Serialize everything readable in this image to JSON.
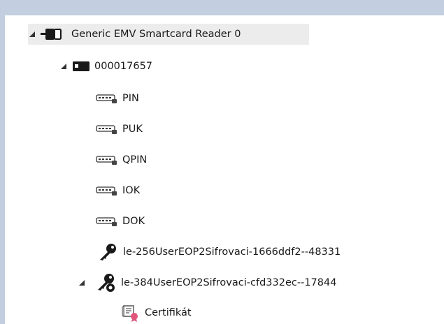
{
  "tree": {
    "reader": {
      "label": "Generic EMV Smartcard Reader 0",
      "icon": "card-reader-icon",
      "expanded": true
    },
    "card": {
      "label": "000017657",
      "icon": "smartcard-icon",
      "expanded": true
    },
    "pins": [
      {
        "label": "PIN",
        "icon": "pin-pad-icon"
      },
      {
        "label": "PUK",
        "icon": "pin-pad-icon"
      },
      {
        "label": "QPIN",
        "icon": "pin-pad-icon"
      },
      {
        "label": "IOK",
        "icon": "pin-pad-icon"
      },
      {
        "label": "DOK",
        "icon": "pin-pad-icon"
      }
    ],
    "keys": [
      {
        "label": "le-256UserEOP2Sifrovaci-1666ddf2--48331",
        "icon": "key-icon",
        "expanded": false
      },
      {
        "label": "le-384UserEOP2Sifrovaci-cfd332ec--17844",
        "icon": "key-with-cert-icon",
        "expanded": true
      }
    ],
    "certificate": {
      "label": "Certifikát",
      "icon": "certificate-icon"
    }
  },
  "colors": {
    "background": "#c3cee0",
    "panel": "#ffffff",
    "selection": "#ececec",
    "icon_dark": "#1a1a1a",
    "cert_badge": "#e0567a"
  }
}
